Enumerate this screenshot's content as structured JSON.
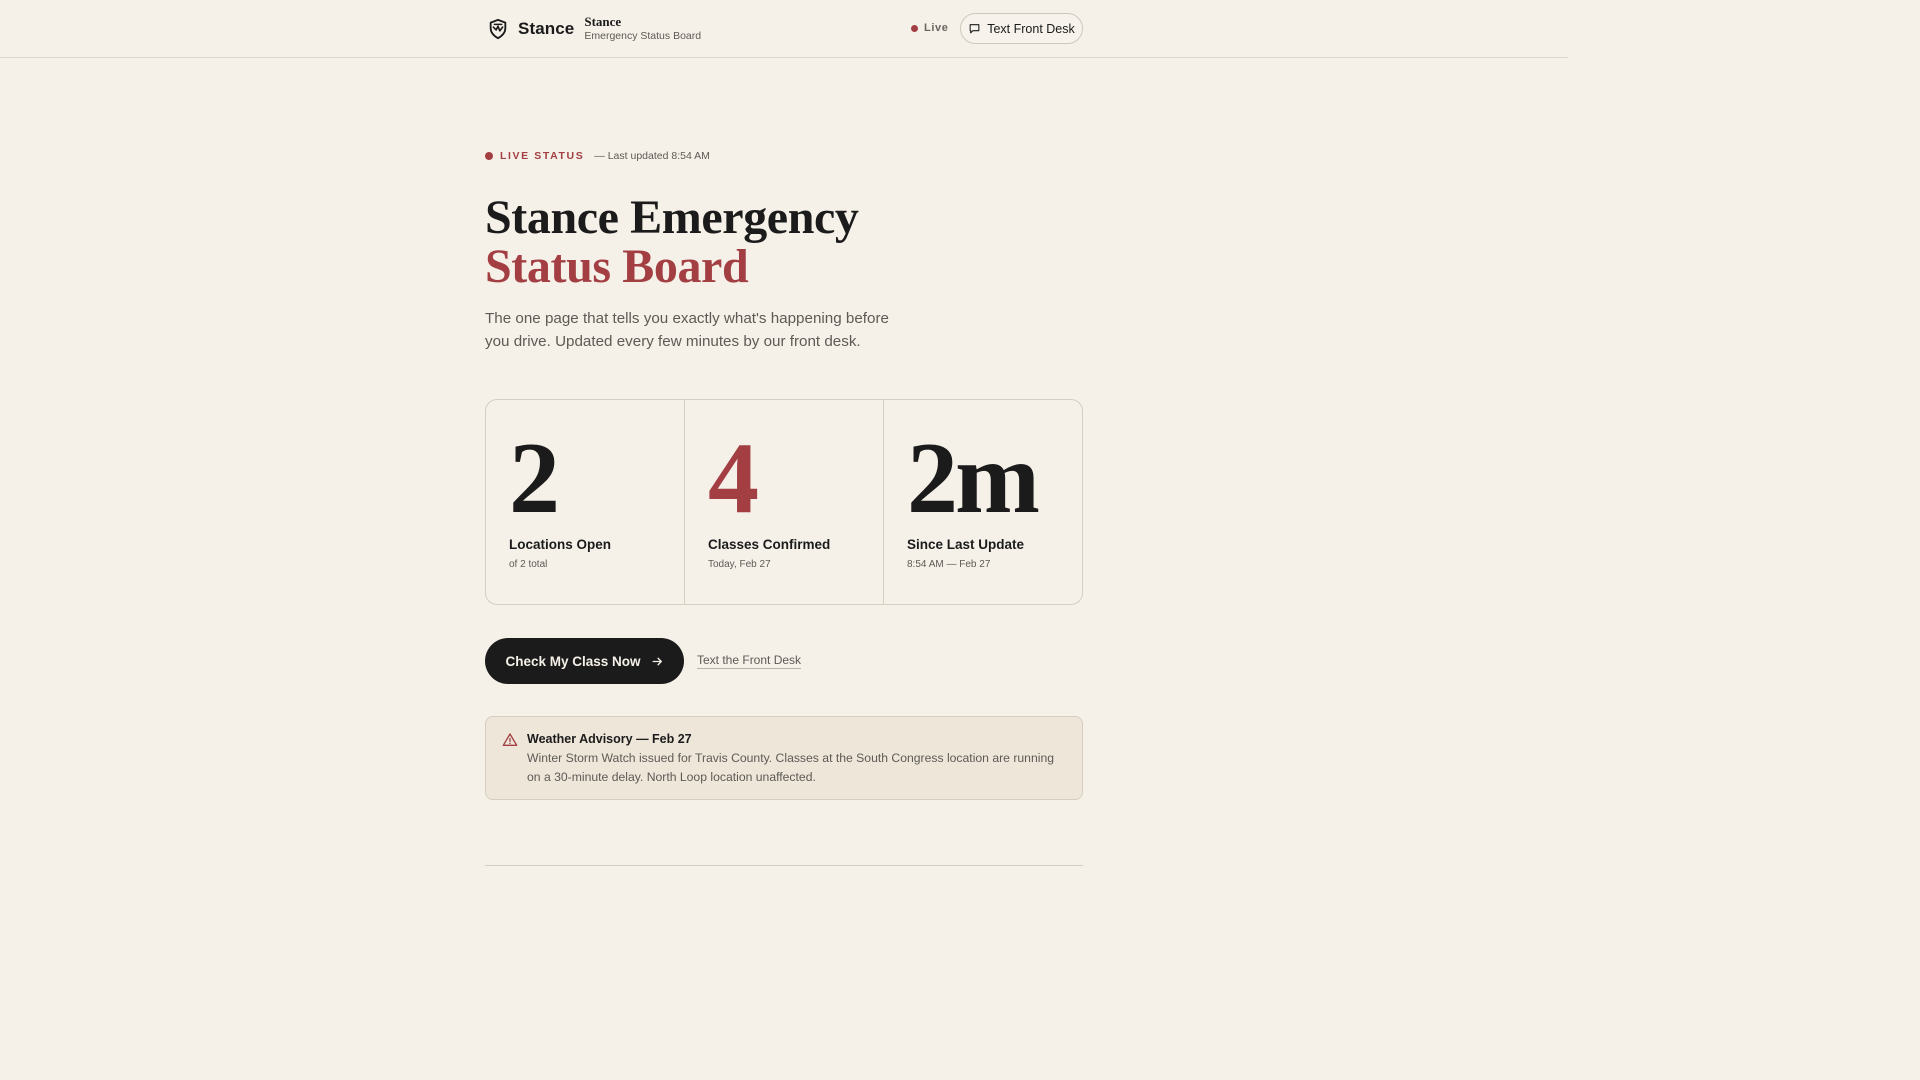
{
  "header": {
    "brand_name": "Stance",
    "brand_subtitle_title": "Stance",
    "brand_subtitle_desc": "Emergency Status Board",
    "logo_icon": "shield-icon",
    "live_label": "Live",
    "text_desk_button": "Text Front Desk",
    "text_desk_icon": "message-icon"
  },
  "status": {
    "label": "LIVE STATUS",
    "updated": "— Last updated 8:54 AM"
  },
  "hero": {
    "title_line1": "Stance Emergency",
    "title_line2": "Status Board",
    "description": "The one page that tells you exactly what's happening before you drive. Updated every few minutes by our front desk."
  },
  "stats": [
    {
      "value": "2",
      "label": "Locations Open",
      "sub": "of 2 total"
    },
    {
      "value": "4",
      "label": "Classes Confirmed",
      "sub": "Today, Feb 27"
    },
    {
      "value": "2m",
      "label": "Since Last Update",
      "sub": "8:54 AM — Feb 27"
    }
  ],
  "actions": {
    "primary": "Check My Class Now",
    "primary_icon": "arrow-right-icon",
    "secondary": "Text the Front Desk"
  },
  "advisory": {
    "icon": "warning-icon",
    "title": "Weather Advisory — Feb 27",
    "body": "Winter Storm Watch issued for Travis County. Classes at the South Congress location are running on a 30-minute delay. North Loop location unaffected."
  },
  "colors": {
    "background": "#f5f0e8",
    "accent": "#a33f43",
    "ink": "#1b1b1b",
    "muted": "#5e5a55"
  }
}
